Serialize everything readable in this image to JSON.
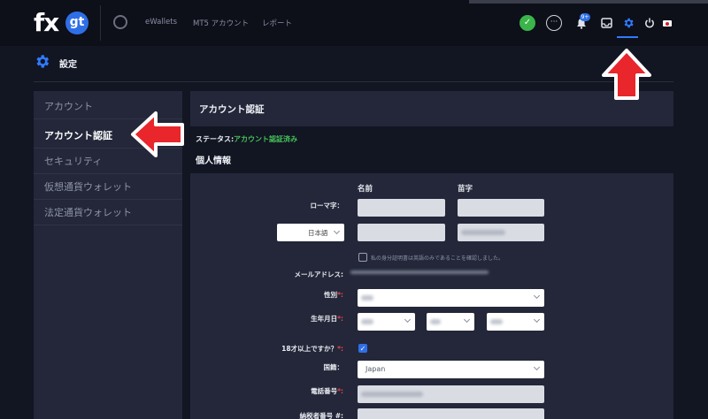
{
  "topbar": {
    "logo_fx": "fx",
    "logo_gt": "gt",
    "nav": [
      {
        "label": "eWallets"
      },
      {
        "label": "MT5 アカウント"
      },
      {
        "label": "レポート"
      }
    ],
    "notification_count": "9+"
  },
  "page": {
    "title": "設定"
  },
  "sidebar": {
    "items": [
      {
        "label": "アカウント"
      },
      {
        "label": "アカウント認証"
      },
      {
        "label": "セキュリティ"
      },
      {
        "label": "仮想通貨ウォレット"
      },
      {
        "label": "法定通貨ウォレット"
      }
    ]
  },
  "main": {
    "card_title": "アカウント認証",
    "status_label": "ステータス:",
    "status_value": "アカウント認証済み",
    "section_title": "個人情報",
    "col_first": "名前",
    "col_last": "苗字",
    "fields": {
      "romaji": "ローマ字：",
      "language": "日本語",
      "confirm": "私の身分証明書は英語のみであることを確認しました。",
      "email": "メールアドレス:",
      "gender": "性別",
      "birthdate": "生年月日",
      "adult": "18才以上ですか？",
      "nationality": "国籍：",
      "nationality_value": "Japan",
      "phone": "電話番号",
      "tax": "納税者番号 #:"
    },
    "required_mark": "*:"
  },
  "colors": {
    "accent": "#2f7bff",
    "success": "#46c35a",
    "arrow": "#e8262b"
  }
}
